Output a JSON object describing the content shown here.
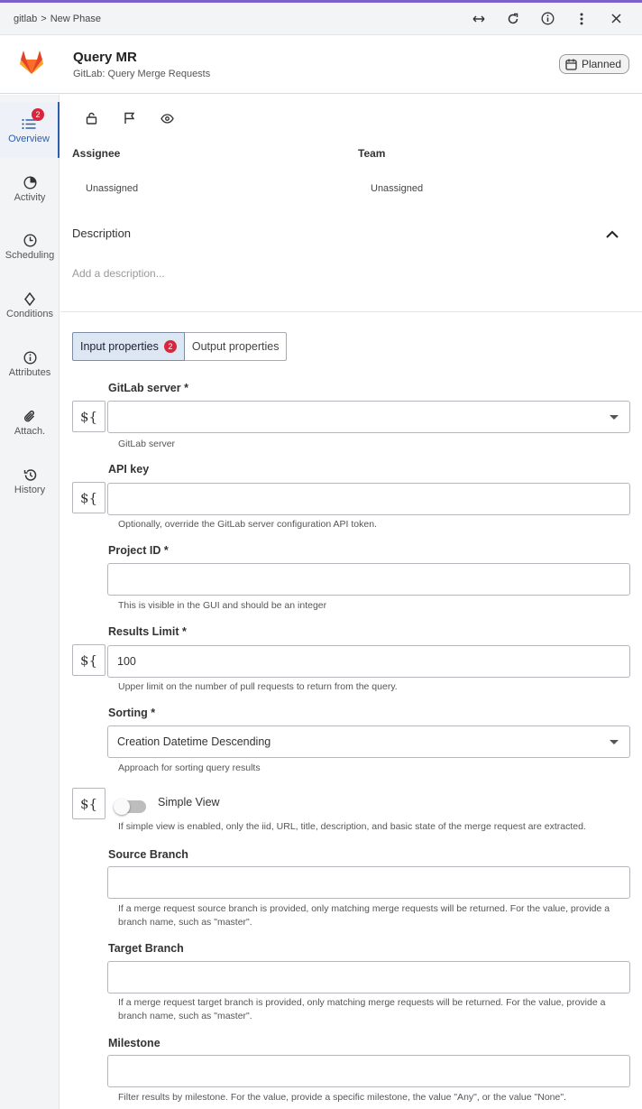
{
  "breadcrumb": {
    "root": "gitlab",
    "separator": ">",
    "current": "New Phase"
  },
  "top_icons": [
    "expand-horizontal-icon",
    "refresh-icon",
    "info-icon",
    "more-vertical-icon",
    "close-icon"
  ],
  "header": {
    "title": "Query MR",
    "subtitle": "GitLab: Query Merge Requests",
    "status": "Planned"
  },
  "sidebar": {
    "items": [
      {
        "label": "Overview",
        "icon": "list-icon",
        "badge": "2"
      },
      {
        "label": "Activity",
        "icon": "pie-icon"
      },
      {
        "label": "Scheduling",
        "icon": "clock-icon"
      },
      {
        "label": "Conditions",
        "icon": "diamond-icon"
      },
      {
        "label": "Attributes",
        "icon": "info-icon"
      },
      {
        "label": "Attach.",
        "icon": "paperclip-icon"
      },
      {
        "label": "History",
        "icon": "history-icon"
      }
    ]
  },
  "assignment": {
    "assignee_label": "Assignee",
    "assignee_value": "Unassigned",
    "team_label": "Team",
    "team_value": "Unassigned"
  },
  "description": {
    "label": "Description",
    "placeholder": "Add a description..."
  },
  "tabs": {
    "input": "Input properties",
    "input_badge": "2",
    "output": "Output properties"
  },
  "expr_symbol": "${",
  "form": {
    "gitlab_server": {
      "label": "GitLab server *",
      "value": "",
      "help": "GitLab server"
    },
    "api_key": {
      "label": "API key",
      "value": "",
      "help": "Optionally, override the GitLab server configuration API token."
    },
    "project_id": {
      "label": "Project ID *",
      "value": "",
      "help": "This is visible in the GUI and should be an integer"
    },
    "results_limit": {
      "label": "Results Limit *",
      "value": "100",
      "help": "Upper limit on the number of pull requests to return from the query."
    },
    "sorting": {
      "label": "Sorting *",
      "value": "Creation Datetime Descending",
      "help": "Approach for sorting query results"
    },
    "simple_view": {
      "label": "Simple View",
      "enabled": false,
      "help": "If simple view is enabled, only the iid, URL, title, description, and basic state of the merge request are extracted."
    },
    "source_branch": {
      "label": "Source Branch",
      "value": "",
      "help": "If a merge request source branch is provided, only matching merge requests will be returned. For the value, provide a branch name, such as \"master\"."
    },
    "target_branch": {
      "label": "Target Branch",
      "value": "",
      "help": "If a merge request target branch is provided, only matching merge requests will be returned. For the value, provide a branch name, such as \"master\"."
    },
    "milestone": {
      "label": "Milestone",
      "value": "",
      "help": "Filter results by milestone. For the value, provide a specific milestone, the value \"Any\", or the value \"None\"."
    }
  },
  "colors": {
    "accent": "#2f5ea8",
    "badge": "#d7263d",
    "brand_orange": "#e24329",
    "top_line": "#7b61c9"
  }
}
